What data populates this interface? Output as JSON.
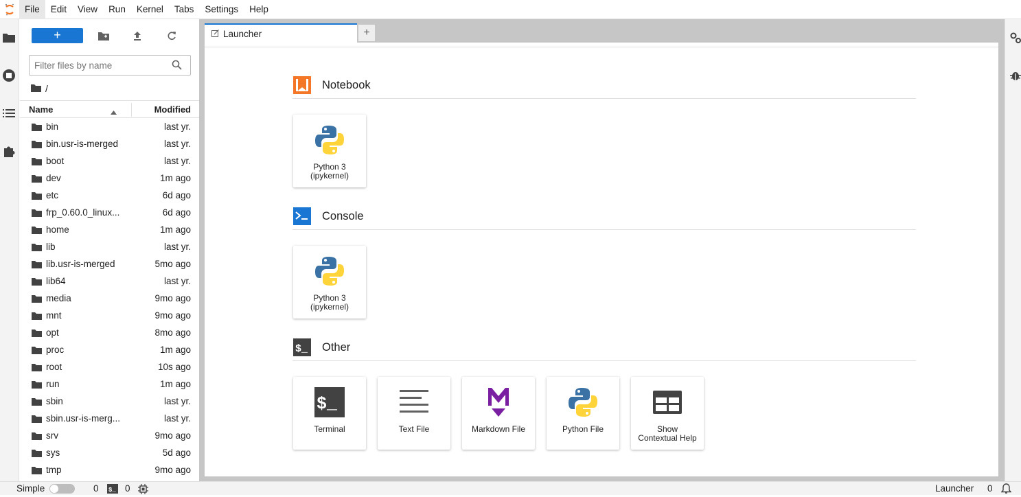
{
  "menubar": {
    "items": [
      "File",
      "Edit",
      "View",
      "Run",
      "Kernel",
      "Tabs",
      "Settings",
      "Help"
    ],
    "active": "File"
  },
  "left_rail": [
    "folder-icon",
    "running-icon",
    "toc-icon",
    "extension-icon"
  ],
  "right_rail": [
    "property-inspector-icon",
    "debugger-icon"
  ],
  "filebrowser": {
    "new_label": "+",
    "filter_placeholder": "Filter files by name",
    "breadcrumb": "/",
    "columns": {
      "name": "Name",
      "modified": "Modified"
    },
    "rows": [
      {
        "name": "bin",
        "modified": "last yr."
      },
      {
        "name": "bin.usr-is-merged",
        "modified": "last yr."
      },
      {
        "name": "boot",
        "modified": "last yr."
      },
      {
        "name": "dev",
        "modified": "1m ago"
      },
      {
        "name": "etc",
        "modified": "6d ago"
      },
      {
        "name": "frp_0.60.0_linux...",
        "modified": "6d ago"
      },
      {
        "name": "home",
        "modified": "1m ago"
      },
      {
        "name": "lib",
        "modified": "last yr."
      },
      {
        "name": "lib.usr-is-merged",
        "modified": "5mo ago"
      },
      {
        "name": "lib64",
        "modified": "last yr."
      },
      {
        "name": "media",
        "modified": "9mo ago"
      },
      {
        "name": "mnt",
        "modified": "9mo ago"
      },
      {
        "name": "opt",
        "modified": "8mo ago"
      },
      {
        "name": "proc",
        "modified": "1m ago"
      },
      {
        "name": "root",
        "modified": "10s ago"
      },
      {
        "name": "run",
        "modified": "1m ago"
      },
      {
        "name": "sbin",
        "modified": "last yr."
      },
      {
        "name": "sbin.usr-is-merg...",
        "modified": "last yr."
      },
      {
        "name": "srv",
        "modified": "9mo ago"
      },
      {
        "name": "sys",
        "modified": "5d ago"
      },
      {
        "name": "tmp",
        "modified": "9mo ago"
      }
    ]
  },
  "tabs": {
    "active_label": "Launcher",
    "add_label": "+"
  },
  "launcher": {
    "sections": [
      {
        "title": "Notebook",
        "cards": [
          {
            "label1": "Python 3",
            "label2": "(ipykernel)"
          }
        ]
      },
      {
        "title": "Console",
        "cards": [
          {
            "label1": "Python 3",
            "label2": "(ipykernel)"
          }
        ]
      },
      {
        "title": "Other",
        "cards": [
          {
            "label1": "Terminal",
            "label2": ""
          },
          {
            "label1": "Text File",
            "label2": ""
          },
          {
            "label1": "Markdown File",
            "label2": ""
          },
          {
            "label1": "Python File",
            "label2": ""
          },
          {
            "label1": "Show",
            "label2": "Contextual Help"
          }
        ]
      }
    ]
  },
  "statusbar": {
    "mode_label": "Simple",
    "terminals_count": "0",
    "kernels_count": "0",
    "right_label": "Launcher",
    "notifications_count": "0"
  },
  "colors": {
    "accent": "#1976d2",
    "notebook_icon": "#f37726",
    "markdown_icon": "#7b1fa2",
    "python_blue": "#3a72a5",
    "python_yellow": "#ffd43b"
  }
}
